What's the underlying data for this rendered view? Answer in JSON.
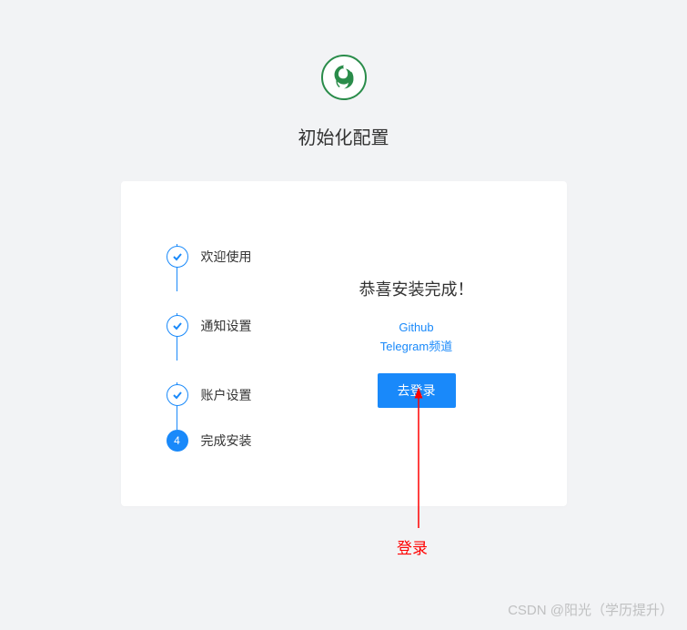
{
  "page_title": "初始化配置",
  "steps": [
    {
      "label": "欢迎使用",
      "status": "done"
    },
    {
      "label": "通知设置",
      "status": "done"
    },
    {
      "label": "账户设置",
      "status": "done"
    },
    {
      "label": "完成安装",
      "status": "current",
      "number": "4"
    }
  ],
  "content": {
    "success_title": "恭喜安装完成！",
    "links": {
      "github": "Github",
      "telegram": "Telegram频道"
    },
    "login_button": "去登录"
  },
  "annotation": {
    "label": "登录"
  },
  "watermark": "CSDN @阳光（学历提升）"
}
